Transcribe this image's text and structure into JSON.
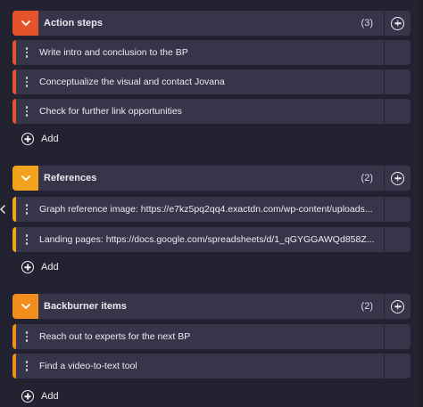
{
  "groups": [
    {
      "title": "Action steps",
      "count": "(3)",
      "color": "#e4532a",
      "items": [
        "Write intro and conclusion to the BP",
        "Conceptualize the visual and contact Jovana",
        "Check for further link opportunities"
      ],
      "add_label": "Add"
    },
    {
      "title": "References",
      "count": "(2)",
      "color": "#f2a31b",
      "items": [
        "Graph reference image: https://e7kz5pq2qq4.exactdn.com/wp-content/uploads...",
        "Landing pages: https://docs.google.com/spreadsheets/d/1_qGYGGAWQd858Z..."
      ],
      "add_label": "Add"
    },
    {
      "title": "Backburner items",
      "count": "(2)",
      "color": "#f28e1b",
      "items": [
        "Reach out to experts for the next BP",
        "Find a video-to-text tool"
      ],
      "add_label": "Add"
    }
  ],
  "icons": {
    "group_toggle": "chevron-down-icon",
    "add": "plus-circle-icon",
    "drag": "drag-handle-icon",
    "collapse": "chevron-left-icon"
  }
}
